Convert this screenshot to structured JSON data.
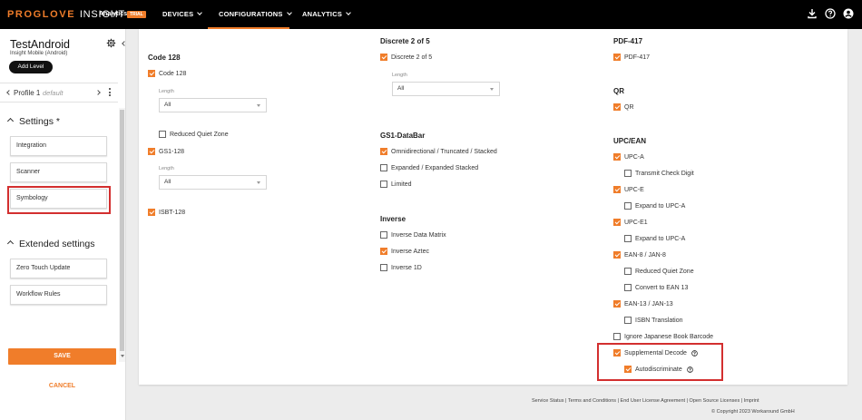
{
  "topbar": {
    "brand_main": "PROGLOVE",
    "brand_sub": "INSIGHT",
    "product": "Analytics",
    "badge": "TRIAL",
    "nav": [
      {
        "label": "DEVICES"
      },
      {
        "label": "CONFIGURATIONS"
      },
      {
        "label": "ANALYTICS"
      }
    ],
    "icons": [
      "download-icon",
      "help-icon",
      "account-icon"
    ],
    "accent_color": "#f07d2a"
  },
  "sidebar": {
    "title": "TestAndroid",
    "subtitle": "Insight Mobile (Android)",
    "add_level": "Add Level",
    "profile_name": "Profile 1",
    "profile_default": "default",
    "settings_heading": "Settings *",
    "settings_items": [
      {
        "label": "Integration"
      },
      {
        "label": "Scanner"
      },
      {
        "label": "Symbology"
      }
    ],
    "extended_heading": "Extended settings",
    "extended_items": [
      {
        "label": "Zero Touch Update"
      },
      {
        "label": "Workflow Rules"
      }
    ],
    "save": "SAVE",
    "cancel": "CANCEL"
  },
  "symbology": {
    "col1": {
      "title": "Code 128",
      "code128": {
        "label": "Code 128",
        "checked": true
      },
      "length_label": "Length",
      "length_value": "All",
      "reduced_quiet_zone": {
        "label": "Reduced Quiet Zone",
        "checked": false
      },
      "gs1_128": {
        "label": "GS1-128",
        "checked": true
      },
      "gs1_length_label": "Length",
      "gs1_length_value": "All",
      "isbt_128": {
        "label": "ISBT-128",
        "checked": true
      }
    },
    "col2": {
      "title": "Discrete 2 of 5",
      "discrete": {
        "label": "Discrete 2 of 5",
        "checked": true
      },
      "length_label": "Length",
      "length_value": "All",
      "databar_title": "GS1-DataBar",
      "databar_items": [
        {
          "label": "Omnidirectional / Truncated / Stacked",
          "checked": true
        },
        {
          "label": "Expanded / Expanded Stacked",
          "checked": false
        },
        {
          "label": "Limited",
          "checked": false
        }
      ],
      "inverse_title": "Inverse",
      "inverse_items": [
        {
          "label": "Inverse Data Matrix",
          "checked": false
        },
        {
          "label": "Inverse Aztec",
          "checked": true
        },
        {
          "label": "Inverse 1D",
          "checked": false
        }
      ]
    },
    "col3": {
      "pdf_title": "PDF-417",
      "pdf": {
        "label": "PDF-417",
        "checked": true
      },
      "qr_title": "QR",
      "qr": {
        "label": "QR",
        "checked": true
      },
      "upc_title": "UPC/EAN",
      "upc_items": [
        {
          "label": "UPC-A",
          "checked": true,
          "indent": false
        },
        {
          "label": "Transmit Check Digit",
          "checked": false,
          "indent": true
        },
        {
          "label": "UPC-E",
          "checked": true,
          "indent": false
        },
        {
          "label": "Expand to UPC-A",
          "checked": false,
          "indent": true
        },
        {
          "label": "UPC-E1",
          "checked": true,
          "indent": false
        },
        {
          "label": "Expand to UPC-A",
          "checked": false,
          "indent": true
        },
        {
          "label": "EAN-8 / JAN-8",
          "checked": true,
          "indent": false
        },
        {
          "label": "Reduced Quiet Zone",
          "checked": false,
          "indent": true
        },
        {
          "label": "Convert to EAN 13",
          "checked": false,
          "indent": true
        },
        {
          "label": "EAN-13 / JAN-13",
          "checked": true,
          "indent": false
        },
        {
          "label": "ISBN Translation",
          "checked": false,
          "indent": true
        },
        {
          "label": "Ignore Japanese Book Barcode",
          "checked": false,
          "indent": false
        },
        {
          "label": "Supplemental Decode",
          "checked": true,
          "indent": false,
          "help": true
        },
        {
          "label": "Autodiscriminate",
          "checked": true,
          "indent": true,
          "help": true
        }
      ]
    }
  },
  "footer": {
    "links": "Service Status | Terms and Conditions | End User License Agreement | Open Source Licenses | Imprint",
    "copyright": "© Copyright 2023 Workaround GmbH"
  }
}
